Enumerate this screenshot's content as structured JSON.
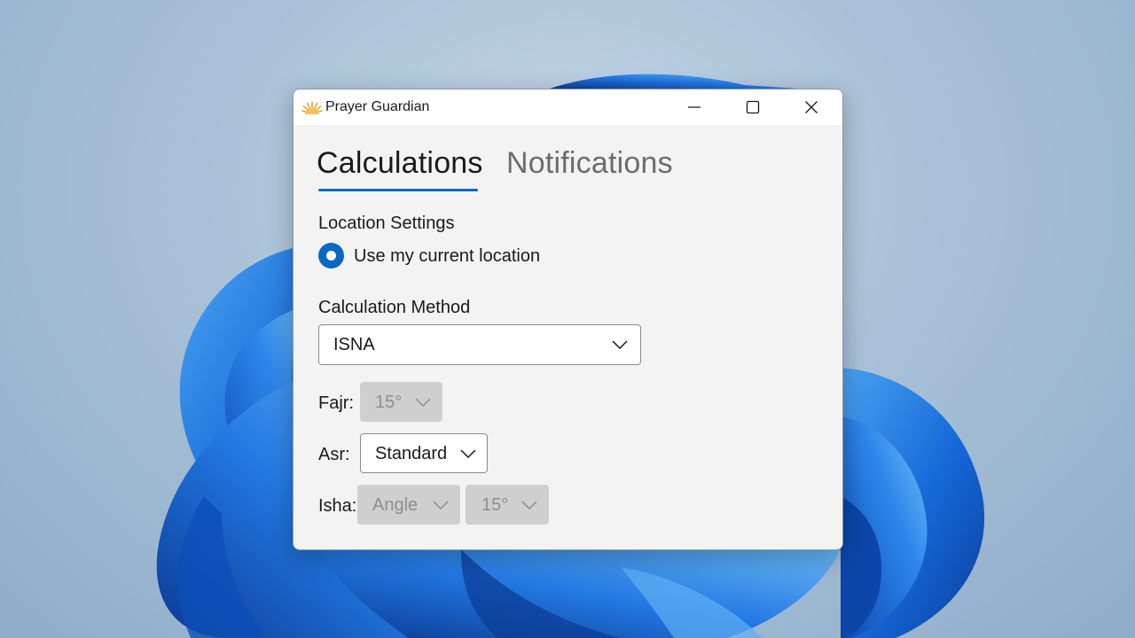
{
  "window": {
    "title": "Prayer Guardian",
    "logo_icon": "sun-rays-icon",
    "accent_color": "#0a67c2"
  },
  "caption_buttons": {
    "minimize_icon": "minimize-icon",
    "maximize_icon": "maximize-icon",
    "close_icon": "close-icon"
  },
  "tabs": [
    {
      "label": "Calculations",
      "active": true
    },
    {
      "label": "Notifications",
      "active": false
    }
  ],
  "location": {
    "heading": "Location Settings",
    "option_label": "Use my current location",
    "selected": true
  },
  "method": {
    "heading": "Calculation Method",
    "selected": "ISNA"
  },
  "fajr": {
    "label": "Fajr:",
    "value": "15°",
    "enabled": false
  },
  "asr": {
    "label": "Asr:",
    "value": "Standard",
    "enabled": true
  },
  "isha": {
    "label": "Isha:",
    "type_value": "Angle",
    "angle_value": "15°",
    "enabled": false
  }
}
